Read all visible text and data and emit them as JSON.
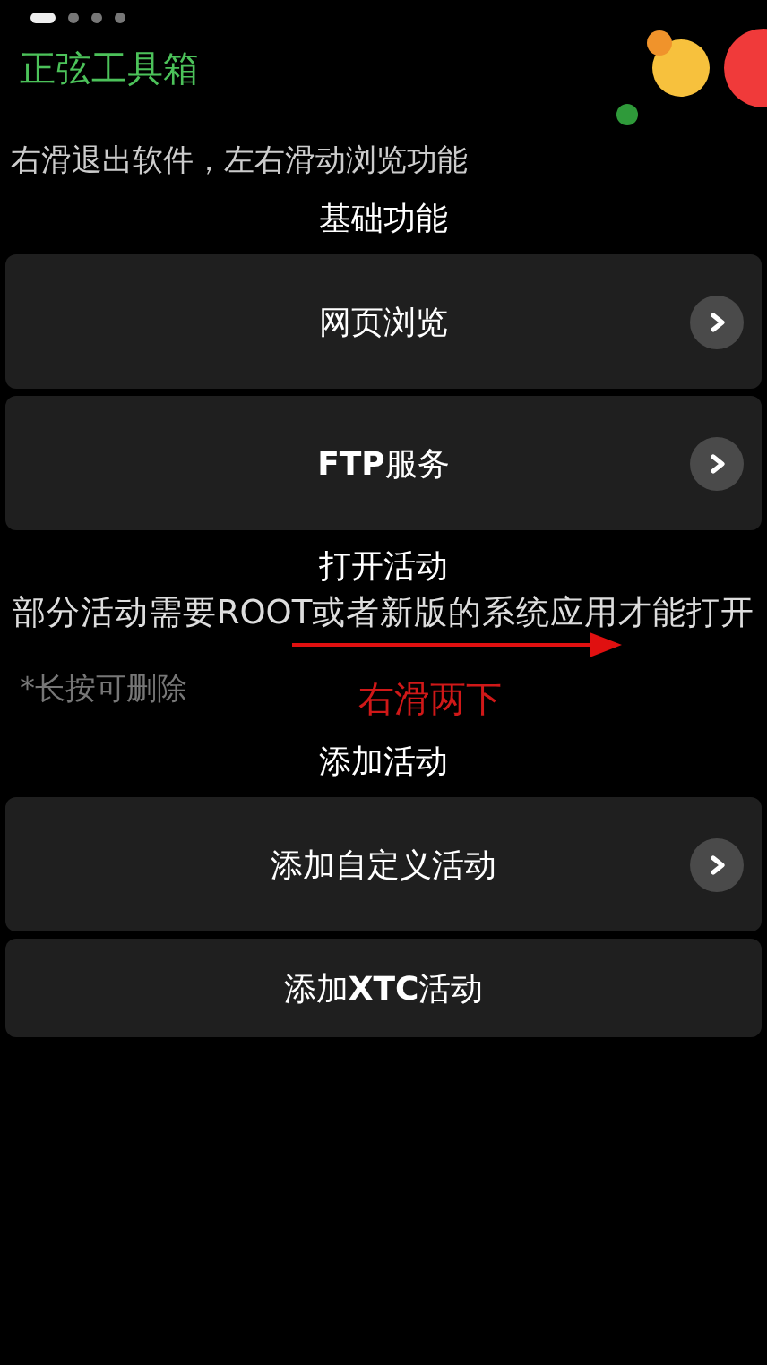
{
  "pager": [
    {
      "selected": true
    },
    {
      "selected": false
    },
    {
      "selected": false
    },
    {
      "selected": false
    }
  ],
  "title": "正弦工具箱",
  "hint": "右滑退出软件，左右滑动浏览功能",
  "sections": [
    {
      "heading": "基础功能",
      "items": [
        {
          "label": "网页浏览",
          "chevron": true
        },
        {
          "label": "**FTP**服务",
          "chevron": true
        }
      ]
    },
    {
      "heading": "打开活动",
      "note": "部分活动需要ROOT或者新版的系统应用才能打开",
      "subnote": "*长按可删除"
    },
    {
      "heading": "添加活动",
      "items": [
        {
          "label": "添加自定义活动",
          "chevron": true
        },
        {
          "label": "添加**XTC**活动",
          "chevron": false
        }
      ]
    }
  ],
  "annotation": {
    "text": "右滑两下"
  }
}
